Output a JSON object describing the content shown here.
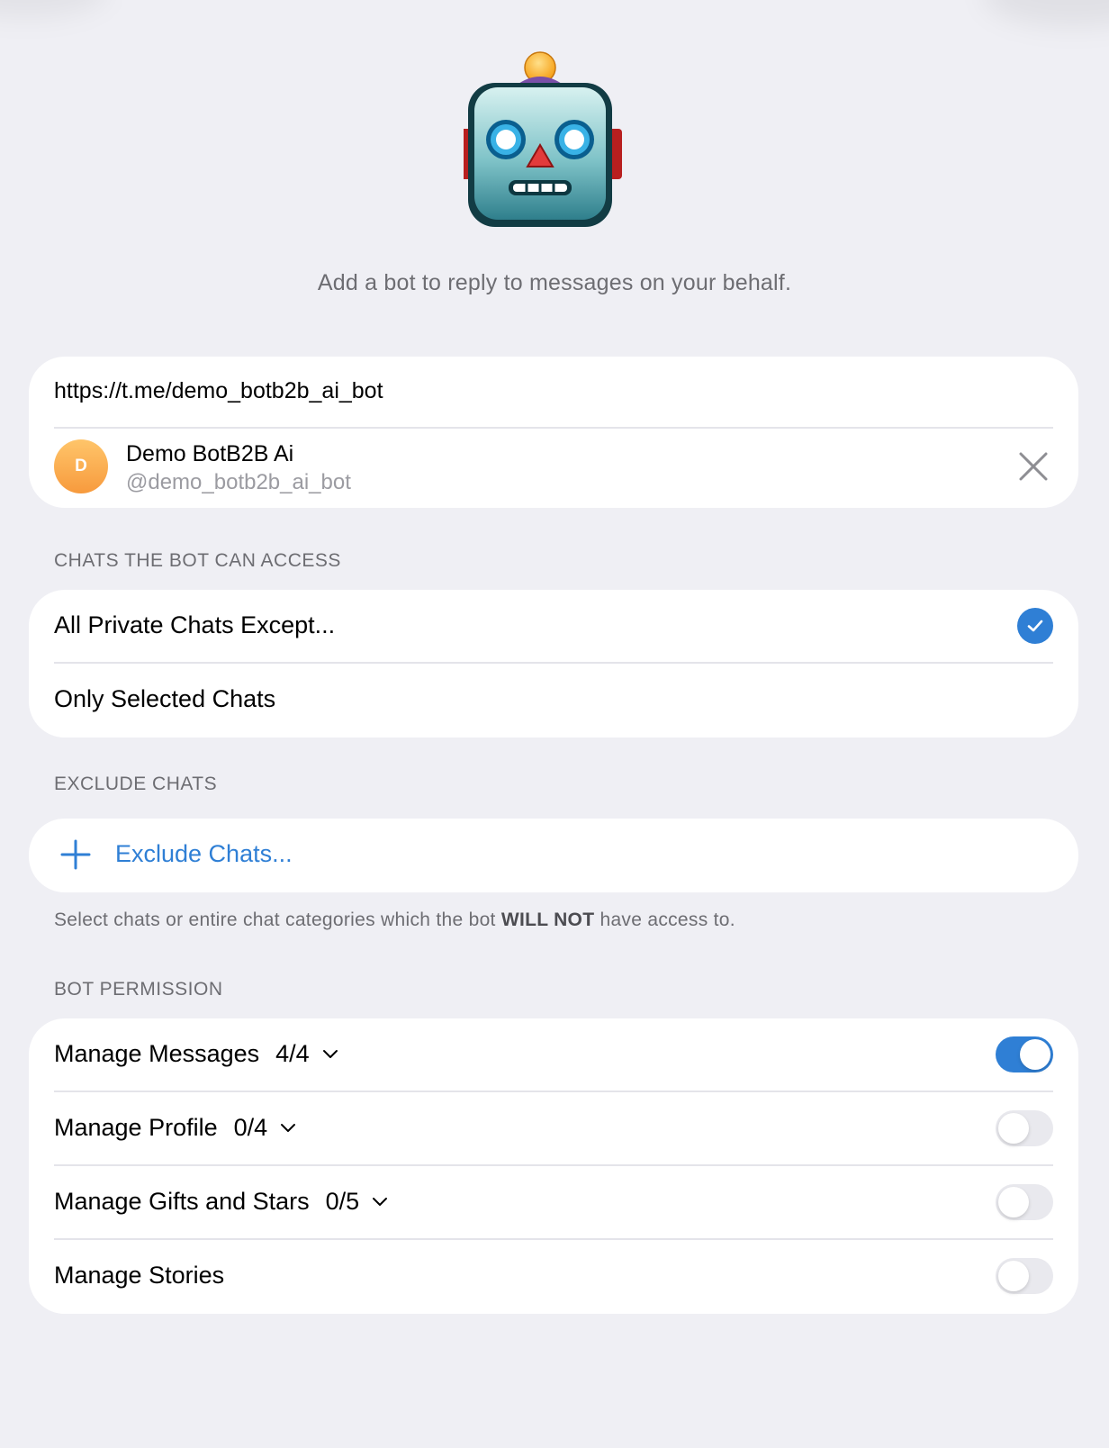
{
  "hero": {
    "icon": "robot-icon",
    "subtitle": "Add a bot to reply to messages on your behalf."
  },
  "bot": {
    "url": "https://t.me/demo_botb2b_ai_bot",
    "avatar_letter": "D",
    "name": "Demo BotB2B Ai",
    "handle": "@demo_botb2b_ai_bot"
  },
  "access": {
    "section_label": "CHATS THE BOT CAN ACCESS",
    "options": [
      {
        "label": "All Private Chats Except...",
        "selected": true
      },
      {
        "label": "Only Selected Chats",
        "selected": false
      }
    ]
  },
  "exclude": {
    "section_label": "EXCLUDE CHATS",
    "button_label": "Exclude Chats...",
    "footnote_pre": "Select chats or entire chat categories which the bot ",
    "footnote_bold": "WILL NOT",
    "footnote_post": " have access to."
  },
  "permissions": {
    "section_label": "BOT PERMISSION",
    "items": [
      {
        "label": "Manage Messages",
        "count": "4/4",
        "enabled": true
      },
      {
        "label": "Manage Profile",
        "count": "0/4",
        "enabled": false
      },
      {
        "label": "Manage Gifts and Stars",
        "count": "0/5",
        "enabled": false
      },
      {
        "label": "Manage Stories",
        "count": "",
        "enabled": false
      }
    ]
  },
  "colors": {
    "accent": "#2f7fd5",
    "background": "#efeff4",
    "avatar": "#f79a3d"
  }
}
